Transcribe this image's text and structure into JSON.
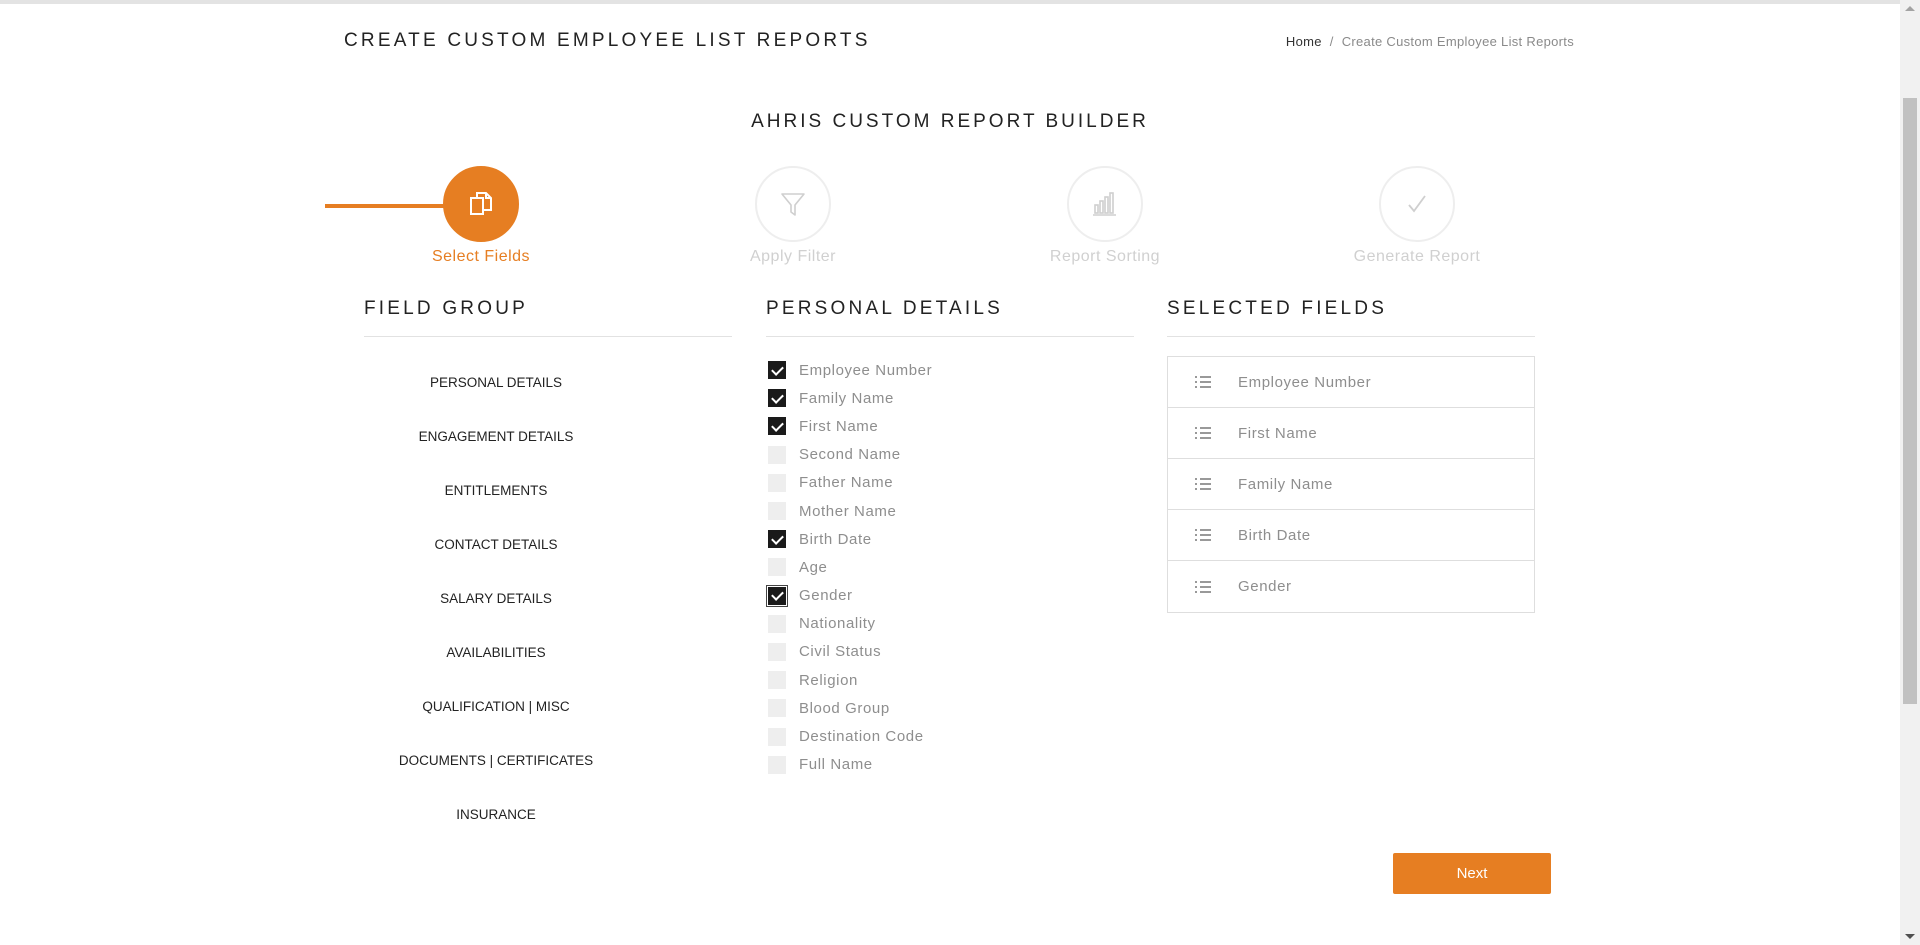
{
  "page": {
    "title": "CREATE CUSTOM EMPLOYEE LIST REPORTS",
    "breadcrumb": {
      "home": "Home",
      "separator": "/",
      "current": "Create Custom Employee List Reports"
    }
  },
  "builder": {
    "title": "AHRIS CUSTOM REPORT BUILDER"
  },
  "steps": [
    {
      "label": "Select Fields",
      "icon": "copy-icon",
      "active": true
    },
    {
      "label": "Apply Filter",
      "icon": "filter-icon",
      "active": false
    },
    {
      "label": "Report Sorting",
      "icon": "bar-chart-icon",
      "active": false
    },
    {
      "label": "Generate Report",
      "icon": "checkmark-icon",
      "active": false
    }
  ],
  "field_group": {
    "heading": "FIELD GROUP",
    "items": [
      "PERSONAL DETAILS",
      "ENGAGEMENT DETAILS",
      "ENTITLEMENTS",
      "CONTACT DETAILS",
      "SALARY DETAILS",
      "AVAILABILITIES",
      "QUALIFICATION | MISC",
      "DOCUMENTS | CERTIFICATES",
      "INSURANCE"
    ]
  },
  "personal_details": {
    "heading": "PERSONAL DETAILS",
    "fields": [
      {
        "label": "Employee Number",
        "checked": true
      },
      {
        "label": "Family Name",
        "checked": true
      },
      {
        "label": "First Name",
        "checked": true
      },
      {
        "label": "Second Name",
        "checked": false
      },
      {
        "label": "Father Name",
        "checked": false
      },
      {
        "label": "Mother Name",
        "checked": false
      },
      {
        "label": "Birth Date",
        "checked": true
      },
      {
        "label": "Age",
        "checked": false
      },
      {
        "label": "Gender",
        "checked": true
      },
      {
        "label": "Nationality",
        "checked": false
      },
      {
        "label": "Civil Status",
        "checked": false
      },
      {
        "label": "Religion",
        "checked": false
      },
      {
        "label": "Blood Group",
        "checked": false
      },
      {
        "label": "Destination Code",
        "checked": false
      },
      {
        "label": "Full Name",
        "checked": false
      }
    ]
  },
  "selected_fields": {
    "heading": "SELECTED FIELDS",
    "items": [
      "Employee Number",
      "First Name",
      "Family Name",
      "Birth Date",
      "Gender"
    ]
  },
  "actions": {
    "next": "Next"
  },
  "colors": {
    "accent": "#e67e22",
    "text": "#222222",
    "muted": "#8e8e8e",
    "inactive": "#d0d0d0"
  }
}
